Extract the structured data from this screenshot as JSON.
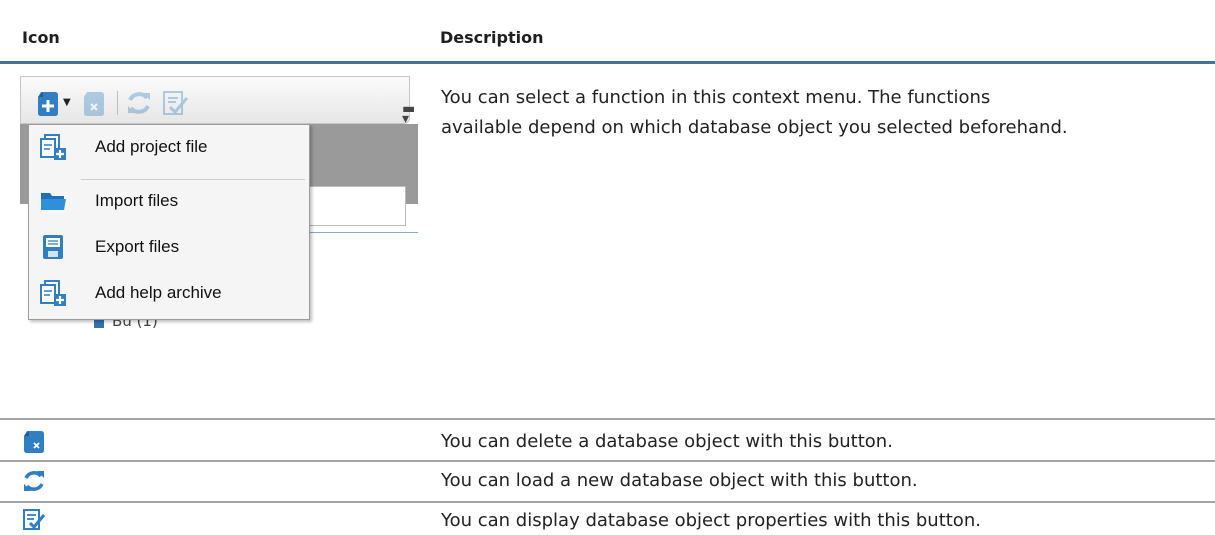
{
  "table": {
    "header": {
      "icon_col": "Icon",
      "description_col": "Description"
    },
    "rows": [
      {
        "icon": "context-menu-screenshot",
        "description_lines": [
          "You can select a function in this context menu. The functions",
          "available depend on which database object you selected beforehand."
        ]
      },
      {
        "icon": "delete-object-icon",
        "description": "You can delete a database object with this button."
      },
      {
        "icon": "refresh-icon",
        "description": "You can load a new database object with this button."
      },
      {
        "icon": "properties-icon",
        "description": "You can display database object properties with this button."
      }
    ]
  },
  "context_menu": {
    "items": [
      {
        "label": "Add project file",
        "icon": "add-file-icon"
      },
      {
        "label": "Import files",
        "icon": "folder-icon"
      },
      {
        "label": "Export files",
        "icon": "save-icon"
      },
      {
        "label": "Add help archive",
        "icon": "add-file-icon"
      }
    ],
    "tree_stub": "Bü (1)"
  },
  "colors": {
    "header_rule": "#42719b",
    "row_rule": "#a4a4a4",
    "icon_blue": "#2f7fc1"
  }
}
